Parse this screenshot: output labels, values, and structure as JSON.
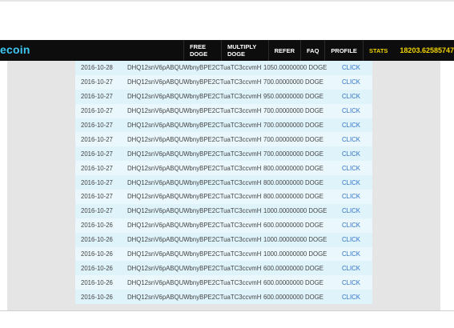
{
  "header": {
    "logo": "ecoin",
    "nav": [
      "FREE DOGE",
      "MULTIPLY DOGE",
      "REFER",
      "FAQ",
      "PROFILE",
      "STATS"
    ],
    "balance": "18203.62585747"
  },
  "rows": [
    {
      "date": "2016-10-28",
      "address": "DHQ12snV6pABQUWbnyBPE2CTuaTC3ccvmH",
      "amount": "1050.00000000 DOGE",
      "action": "CLICK"
    },
    {
      "date": "2016-10-27",
      "address": "DHQ12snV6pABQUWbnyBPE2CTuaTC3ccvmH",
      "amount": "700.00000000 DOGE",
      "action": "CLICK"
    },
    {
      "date": "2016-10-27",
      "address": "DHQ12snV6pABQUWbnyBPE2CTuaTC3ccvmH",
      "amount": "950.00000000 DOGE",
      "action": "CLICK"
    },
    {
      "date": "2016-10-27",
      "address": "DHQ12snV6pABQUWbnyBPE2CTuaTC3ccvmH",
      "amount": "700.00000000 DOGE",
      "action": "CLICK"
    },
    {
      "date": "2016-10-27",
      "address": "DHQ12snV6pABQUWbnyBPE2CTuaTC3ccvmH",
      "amount": "700.00000000 DOGE",
      "action": "CLICK"
    },
    {
      "date": "2016-10-27",
      "address": "DHQ12snV6pABQUWbnyBPE2CTuaTC3ccvmH",
      "amount": "700.00000000 DOGE",
      "action": "CLICK"
    },
    {
      "date": "2016-10-27",
      "address": "DHQ12snV6pABQUWbnyBPE2CTuaTC3ccvmH",
      "amount": "700.00000000 DOGE",
      "action": "CLICK"
    },
    {
      "date": "2016-10-27",
      "address": "DHQ12snV6pABQUWbnyBPE2CTuaTC3ccvmH",
      "amount": "800.00000000 DOGE",
      "action": "CLICK"
    },
    {
      "date": "2016-10-27",
      "address": "DHQ12snV6pABQUWbnyBPE2CTuaTC3ccvmH",
      "amount": "800.00000000 DOGE",
      "action": "CLICK"
    },
    {
      "date": "2016-10-27",
      "address": "DHQ12snV6pABQUWbnyBPE2CTuaTC3ccvmH",
      "amount": "800.00000000 DOGE",
      "action": "CLICK"
    },
    {
      "date": "2016-10-27",
      "address": "DHQ12snV6pABQUWbnyBPE2CTuaTC3ccvmH",
      "amount": "1000.00000000 DOGE",
      "action": "CLICK"
    },
    {
      "date": "2016-10-26",
      "address": "DHQ12snV6pABQUWbnyBPE2CTuaTC3ccvmH",
      "amount": "600.00000000 DOGE",
      "action": "CLICK"
    },
    {
      "date": "2016-10-26",
      "address": "DHQ12snV6pABQUWbnyBPE2CTuaTC3ccvmH",
      "amount": "1000.00000000 DOGE",
      "action": "CLICK"
    },
    {
      "date": "2016-10-26",
      "address": "DHQ12snV6pABQUWbnyBPE2CTuaTC3ccvmH",
      "amount": "1000.00000000 DOGE",
      "action": "CLICK"
    },
    {
      "date": "2016-10-26",
      "address": "DHQ12snV6pABQUWbnyBPE2CTuaTC3ccvmH",
      "amount": "600.00000000 DOGE",
      "action": "CLICK"
    },
    {
      "date": "2016-10-26",
      "address": "DHQ12snV6pABQUWbnyBPE2CTuaTC3ccvmH",
      "amount": "600.00000000 DOGE",
      "action": "CLICK"
    },
    {
      "date": "2016-10-26",
      "address": "DHQ12snV6pABQUWbnyBPE2CTuaTC3ccvmH",
      "amount": "600.00000000 DOGE",
      "action": "CLICK"
    }
  ]
}
